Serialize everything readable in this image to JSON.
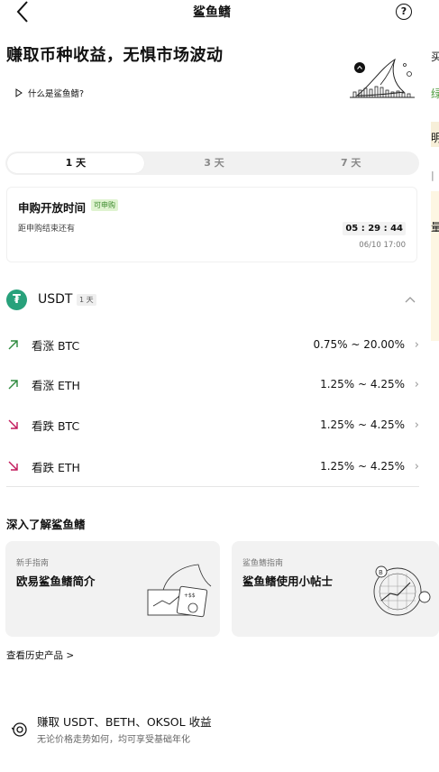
{
  "header": {
    "title": "鲨鱼鳍",
    "help_label": "?"
  },
  "hero": {
    "title": "赚取币种收益，无惧市场波动",
    "whatis_label": "什么是鲨鱼鳍?"
  },
  "peek": {
    "chars": [
      "买",
      "绿",
      "明",
      "|",
      "量"
    ]
  },
  "tabs": [
    {
      "label": "1 天",
      "active": true
    },
    {
      "label": "3 天",
      "active": false
    },
    {
      "label": "7 天",
      "active": false
    }
  ],
  "subscription": {
    "title": "申购开放时间",
    "badge": "可申购",
    "subtitle": "距申购结束还有",
    "countdown": "05 : 29 : 44",
    "deadline": "06/10 17:00"
  },
  "coin": {
    "icon_glyph": "₮",
    "name": "USDT",
    "term_badge": "1 天"
  },
  "products": [
    {
      "direction": "up",
      "label": "看涨 BTC",
      "rate": "0.75% ~ 20.00%"
    },
    {
      "direction": "up",
      "label": "看涨 ETH",
      "rate": "1.25% ~ 4.25%"
    },
    {
      "direction": "down",
      "label": "看跌 BTC",
      "rate": "1.25% ~ 4.25%"
    },
    {
      "direction": "down",
      "label": "看跌 ETH",
      "rate": "1.25% ~ 4.25%"
    }
  ],
  "colors": {
    "up": "#2e8a3e",
    "down": "#c2185b",
    "coin": "#28a17b",
    "badge_bg": "#dff3d0"
  },
  "learn": {
    "title": "深入了解鲨鱼鳍",
    "cards": [
      {
        "tag": "新手指南",
        "title": "欧易鲨鱼鳍简介"
      },
      {
        "tag": "鲨鱼鳍指南",
        "title": "鲨鱼鳍使用小帖士"
      }
    ]
  },
  "history_label": "查看历史产品 >",
  "feature": {
    "title": "赚取 USDT、BETH、OKSOL 收益",
    "subtitle": "无论价格走势如何，均可享受基础年化"
  }
}
